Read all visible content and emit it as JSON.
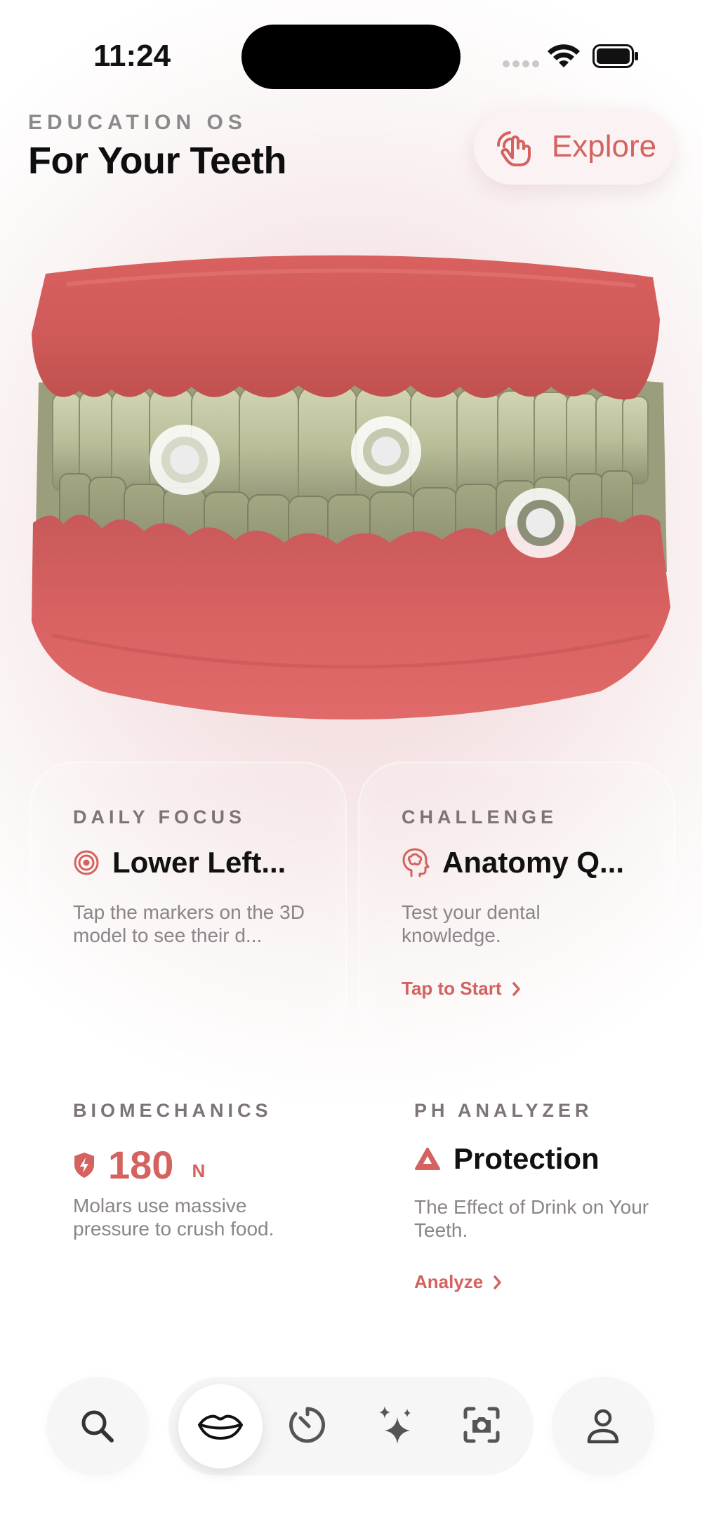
{
  "status_bar": {
    "time": "11:24"
  },
  "header": {
    "kicker": "EDUCATION OS",
    "title": "For Your Teeth",
    "explore_label": "Explore"
  },
  "colors": {
    "accent": "#d4625f",
    "gum": "#d9605f",
    "tooth": "#b9bd98",
    "muted_text": "#8b8587"
  },
  "cards": {
    "daily_focus": {
      "kicker": "DAILY FOCUS",
      "title": "Lower Left...",
      "description": "Tap the markers on the 3D model to see their d...",
      "icon": "target-icon"
    },
    "challenge": {
      "kicker": "CHALLENGE",
      "title": "Anatomy Q...",
      "description": "Test your dental knowledge.",
      "cta": "Tap to Start",
      "icon": "brain-icon"
    },
    "biomechanics": {
      "kicker": "BIOMECHANICS",
      "value": "180",
      "unit": "N",
      "description": "Molars use massive pressure to crush food.",
      "icon": "bolt-shield-icon"
    },
    "ph_analyzer": {
      "kicker": "PH ANALYZER",
      "title": "Protection",
      "description": "The Effect of Drink on Your Teeth.",
      "cta": "Analyze",
      "icon": "warning-icon"
    }
  },
  "tab_bar": {
    "items": [
      "search-icon",
      "lips-icon",
      "timer-icon",
      "sparkles-icon",
      "camera-scan-icon",
      "profile-icon"
    ],
    "active": "lips-icon"
  }
}
